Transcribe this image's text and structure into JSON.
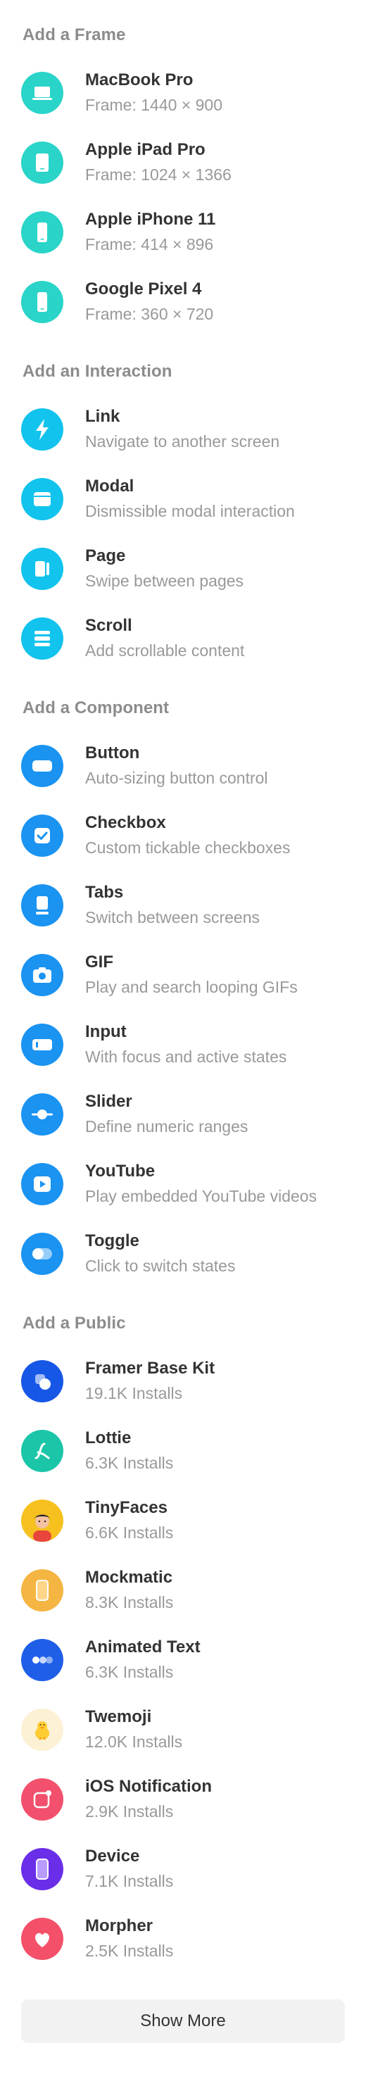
{
  "sections": {
    "frames": {
      "title": "Add a Frame",
      "items": [
        {
          "title": "MacBook Pro",
          "subtitle": "Frame: 1440 × 900",
          "icon": "laptop-icon"
        },
        {
          "title": "Apple iPad Pro",
          "subtitle": "Frame: 1024 × 1366",
          "icon": "tablet-icon"
        },
        {
          "title": "Apple iPhone 11",
          "subtitle": "Frame: 414 × 896",
          "icon": "phone-icon"
        },
        {
          "title": "Google Pixel 4",
          "subtitle": "Frame: 360 × 720",
          "icon": "phone-icon"
        }
      ]
    },
    "interactions": {
      "title": "Add an Interaction",
      "items": [
        {
          "title": "Link",
          "subtitle": "Navigate to another screen",
          "icon": "lightning-icon"
        },
        {
          "title": "Modal",
          "subtitle": "Dismissible modal interaction",
          "icon": "modal-icon"
        },
        {
          "title": "Page",
          "subtitle": "Swipe between pages",
          "icon": "pages-icon"
        },
        {
          "title": "Scroll",
          "subtitle": "Add scrollable content",
          "icon": "scroll-icon"
        }
      ]
    },
    "components": {
      "title": "Add a Component",
      "items": [
        {
          "title": "Button",
          "subtitle": "Auto-sizing button control",
          "icon": "button-icon"
        },
        {
          "title": "Checkbox",
          "subtitle": "Custom tickable checkboxes",
          "icon": "checkbox-icon"
        },
        {
          "title": "Tabs",
          "subtitle": "Switch between screens",
          "icon": "tabs-icon"
        },
        {
          "title": "GIF",
          "subtitle": "Play and search looping GIFs",
          "icon": "camera-icon"
        },
        {
          "title": "Input",
          "subtitle": "With focus and active states",
          "icon": "input-icon"
        },
        {
          "title": "Slider",
          "subtitle": "Define numeric ranges",
          "icon": "slider-icon"
        },
        {
          "title": "YouTube",
          "subtitle": "Play embedded YouTube videos",
          "icon": "play-icon"
        },
        {
          "title": "Toggle",
          "subtitle": "Click to switch states",
          "icon": "toggle-icon"
        }
      ]
    },
    "public": {
      "title": "Add a Public",
      "items": [
        {
          "title": "Framer Base Kit",
          "subtitle": "19.1K Installs",
          "icon": "framer-base-kit-icon"
        },
        {
          "title": "Lottie",
          "subtitle": "6.3K Installs",
          "icon": "lottie-icon"
        },
        {
          "title": "TinyFaces",
          "subtitle": "6.6K Installs",
          "icon": "tinyfaces-icon"
        },
        {
          "title": "Mockmatic",
          "subtitle": "8.3K Installs",
          "icon": "mockmatic-icon"
        },
        {
          "title": "Animated Text",
          "subtitle": "6.3K Installs",
          "icon": "animated-text-icon"
        },
        {
          "title": "Twemoji",
          "subtitle": "12.0K Installs",
          "icon": "twemoji-chick-icon"
        },
        {
          "title": "iOS Notification",
          "subtitle": "2.9K Installs",
          "icon": "ios-notification-icon"
        },
        {
          "title": "Device",
          "subtitle": "7.1K Installs",
          "icon": "device-icon"
        },
        {
          "title": "Morpher",
          "subtitle": "2.5K Installs",
          "icon": "heart-icon"
        }
      ]
    }
  },
  "show_more_label": "Show More",
  "colors": {
    "frame_icon": "#2ad4c8",
    "interaction_icon": "#11c3ed",
    "component_icon": "#1a93f1"
  }
}
